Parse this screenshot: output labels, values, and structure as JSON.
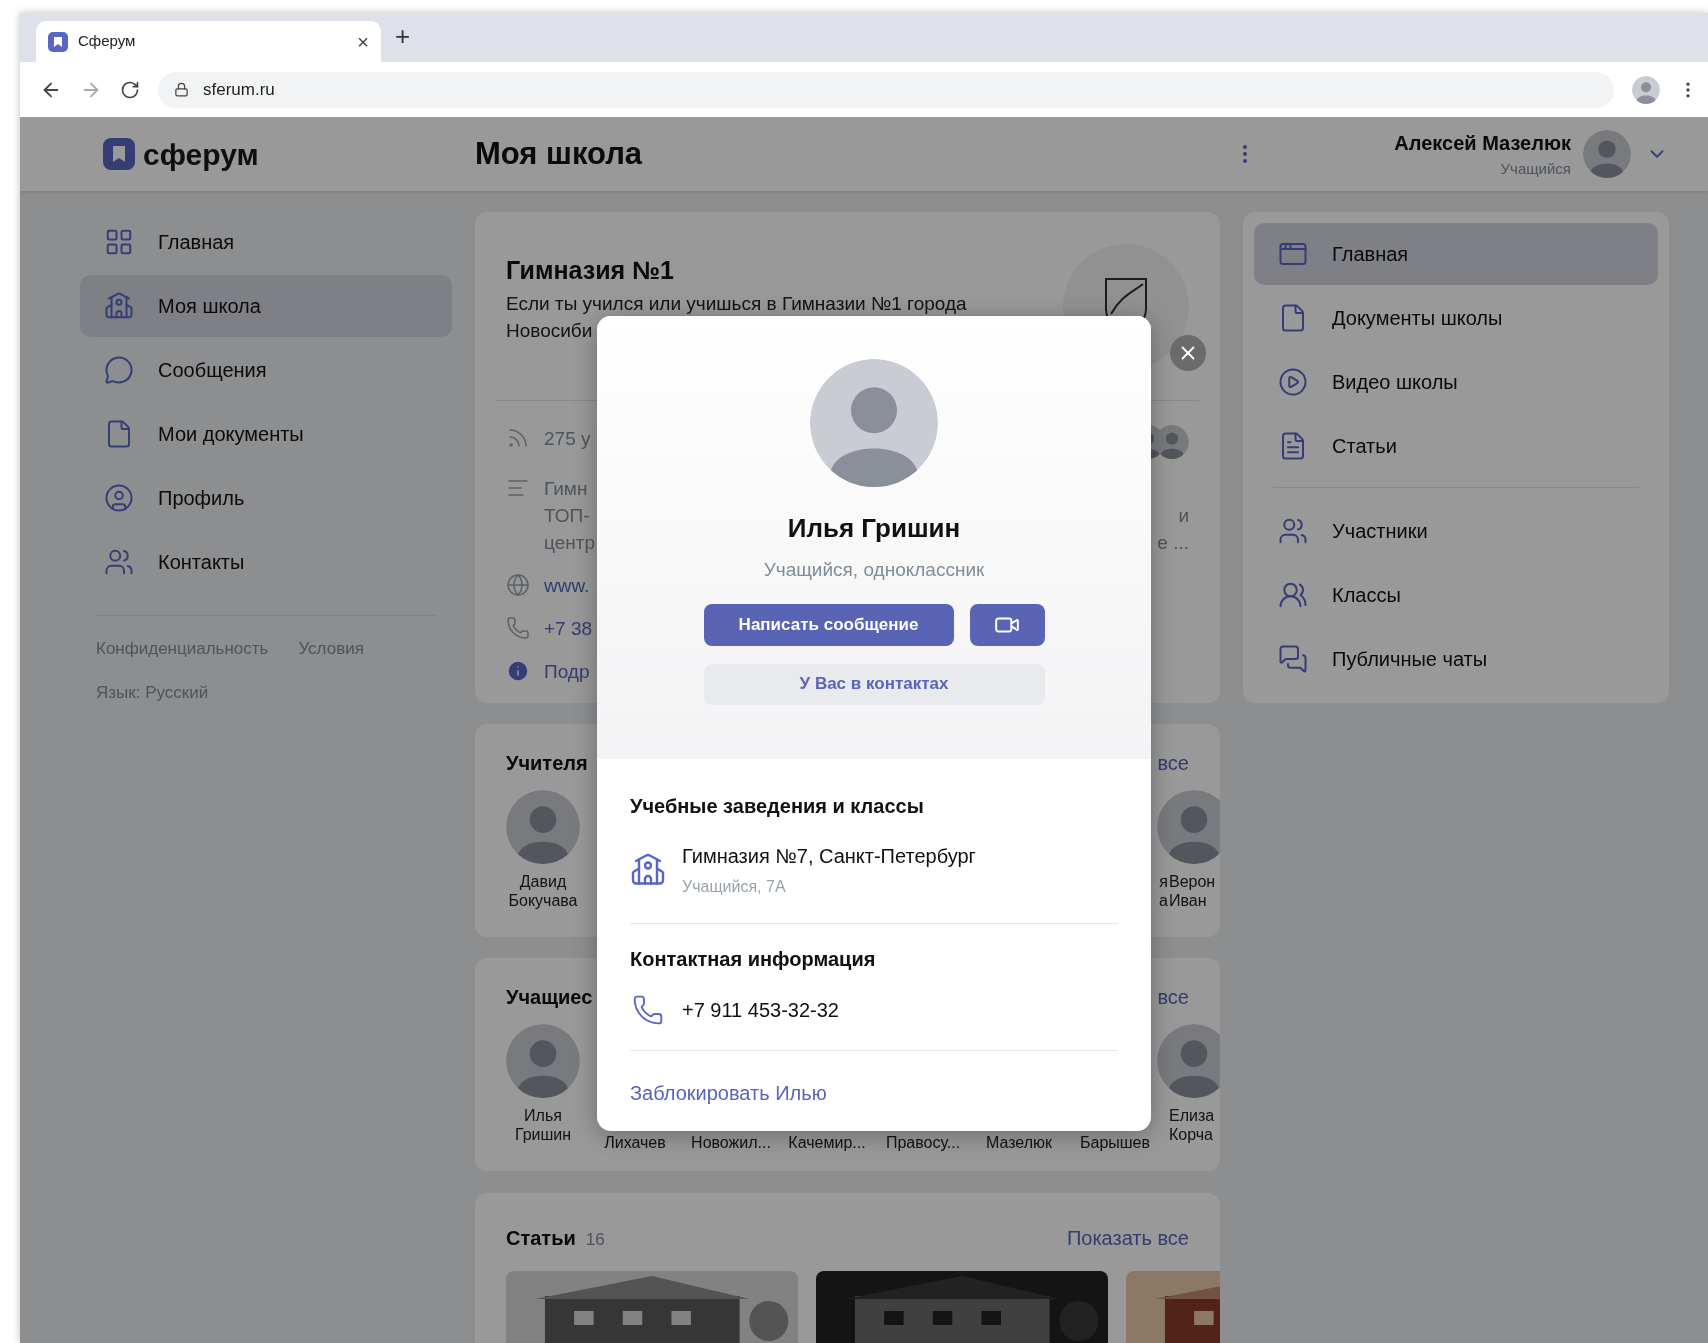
{
  "browser": {
    "tab": {
      "title": "Сферум",
      "close": "×"
    },
    "new_tab": "+",
    "address": "sferum.ru"
  },
  "header": {
    "logo": "сферум",
    "page_title": "Моя школа",
    "user": {
      "name": "Алексей Мазелюк",
      "role": "Учащийся"
    }
  },
  "sidebar": {
    "items": [
      {
        "label": "Главная",
        "selected": false
      },
      {
        "label": "Моя школа",
        "selected": true
      },
      {
        "label": "Сообщения",
        "selected": false
      },
      {
        "label": "Мои документы",
        "selected": false
      },
      {
        "label": "Профиль",
        "selected": false
      },
      {
        "label": "Контакты",
        "selected": false
      }
    ],
    "footer_links": [
      "Конфиденциальность",
      "Условия"
    ],
    "language": "Язык: Русский"
  },
  "school": {
    "name": "Гимназия №1",
    "description_lines": [
      "Если ты учился или учишься в Гимназии №1 города",
      "Новосиби"
    ],
    "rows": [
      {
        "kind": "followers",
        "lines": [
          "275 у"
        ]
      },
      {
        "kind": "about",
        "lines": [
          "Гимн",
          "ТОП-",
          "центр"
        ],
        "right_fragments": [
          "и",
          "е ..."
        ]
      },
      {
        "kind": "website",
        "lines": [
          "www."
        ]
      },
      {
        "kind": "phone",
        "lines": [
          "+7 38"
        ]
      },
      {
        "kind": "details",
        "lines": [
          "Подр"
        ]
      }
    ]
  },
  "teachers": {
    "title": "Учителя",
    "show_all": "все",
    "members": [
      {
        "kind": "full",
        "lines": [
          "Давид",
          "Бокучава"
        ]
      },
      {
        "kind": "cut",
        "lines": [
          "я",
          "а"
        ]
      },
      {
        "kind": "full",
        "lines": [
          "Верон",
          "Иван"
        ]
      }
    ]
  },
  "students": {
    "title": "Учащиес",
    "show_all": "все",
    "members": [
      {
        "kind": "full",
        "lines": [
          "Илья",
          "Гришин"
        ]
      },
      {
        "kind": "partial",
        "lines": [
          "Лихачев"
        ]
      },
      {
        "kind": "partial",
        "lines": [
          "Новожил..."
        ]
      },
      {
        "kind": "partial",
        "lines": [
          "Качемир..."
        ]
      },
      {
        "kind": "partial",
        "lines": [
          "Правосу..."
        ]
      },
      {
        "kind": "partial",
        "lines": [
          "Мазелюк"
        ]
      },
      {
        "kind": "partial",
        "lines": [
          "Барышев"
        ]
      },
      {
        "kind": "full",
        "lines": [
          "Елиза",
          "Корча"
        ]
      }
    ]
  },
  "articles": {
    "title": "Статьи",
    "count": "16",
    "show_all": "Показать все"
  },
  "school_nav": {
    "items": [
      {
        "label": "Главная",
        "selected": true
      },
      {
        "label": "Документы школы",
        "selected": false
      },
      {
        "label": "Видео школы",
        "selected": false
      },
      {
        "label": "Статьи",
        "selected": false
      },
      {
        "label": "Участники",
        "selected": false
      },
      {
        "label": "Классы",
        "selected": false
      },
      {
        "label": "Публичные чаты",
        "selected": false
      }
    ]
  },
  "profile_dialog": {
    "name": "Илья Гришин",
    "subtitle": "Учащийся, одноклассник",
    "message_button": "Написать сообщение",
    "contact_status": "У Вас в контактах",
    "sections": [
      {
        "title": "Учебные заведения и классы",
        "items": [
          {
            "kind": "school",
            "title": "Гимназия №7, Санкт-Петербург",
            "subtitle": "Учащийся, 7А"
          }
        ]
      },
      {
        "title": "Контактная информация",
        "items": [
          {
            "kind": "phone",
            "title": "+7 911 453-32-32"
          }
        ]
      }
    ],
    "block_link": "Заблокировать Илью"
  }
}
